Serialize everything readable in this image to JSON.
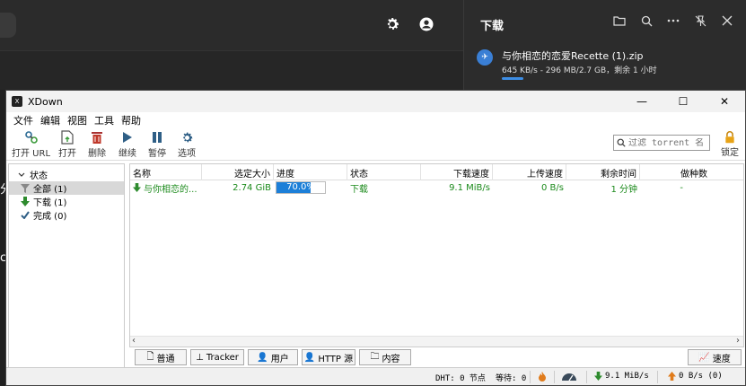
{
  "browser": {
    "settings_icon": "gear-icon",
    "profile_icon": "account-icon",
    "edge_text_1": "分",
    "edge_text_2": "c"
  },
  "downloads_panel": {
    "title": "下载",
    "tools": [
      "folder-icon",
      "search-icon",
      "more-icon",
      "unpin-icon",
      "close-icon"
    ],
    "item": {
      "name": "与你相恋的恋爱Recette (1).zip",
      "status": "645 KB/s - 296 MB/2.7 GB，剩余 1 小时",
      "progress": 0.11
    }
  },
  "window": {
    "title": "XDown",
    "controls": [
      "—",
      "☐",
      "✕"
    ]
  },
  "menu": [
    "文件",
    "编辑",
    "视图",
    "工具",
    "帮助"
  ],
  "toolbar": {
    "open_url": "打开 URL",
    "open": "打开",
    "delete": "删除",
    "resume": "继续",
    "pause": "暂停",
    "options": "选项",
    "search_placeholder": "过滤 torrent 名...",
    "lock": "锁定"
  },
  "sidebar": {
    "header": "状态",
    "items": [
      {
        "label": "全部 (1)"
      },
      {
        "label": "下载 (1)"
      },
      {
        "label": "完成 (0)"
      }
    ]
  },
  "table": {
    "columns": [
      "名称",
      "选定大小",
      "进度",
      "状态",
      "下载速度",
      "上传速度",
      "剩余时间",
      "做种数"
    ],
    "rows": [
      {
        "name": "与你相恋的...",
        "size": "2.74 GiB",
        "progress_text": "70.0%",
        "progress": 0.7,
        "status": "下载",
        "down_speed": "9.1 MiB/s",
        "up_speed": "0 B/s",
        "eta": "1 分钟",
        "seeds": "-"
      }
    ]
  },
  "tabs": [
    "普通",
    "Tracker",
    "用户",
    "HTTP 源",
    "内容"
  ],
  "speed_button": "速度",
  "statusbar": {
    "dht": "DHT: 0 节点",
    "wait": "等待: 0",
    "down": "9.1 MiB/s",
    "up": "0 B/s (0)"
  }
}
